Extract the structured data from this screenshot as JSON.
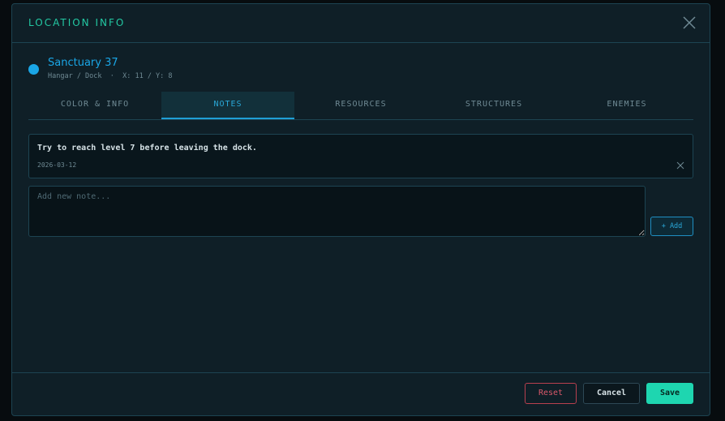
{
  "modal": {
    "title": "LOCATION INFO"
  },
  "location": {
    "name": "Sanctuary 37",
    "meta": "Hangar / Dock  ·  X: 11 / Y: 8",
    "dot_color": "#1aa6e6"
  },
  "tabs": [
    {
      "label": "COLOR & INFO",
      "active": false
    },
    {
      "label": "NOTES",
      "active": true
    },
    {
      "label": "RESOURCES",
      "active": false
    },
    {
      "label": "STRUCTURES",
      "active": false
    },
    {
      "label": "ENEMIES",
      "active": false
    }
  ],
  "notes": [
    {
      "text": "Try to reach level 7 before leaving the dock.",
      "date": "2026-03-12"
    }
  ],
  "new_note": {
    "placeholder": "Add new note...",
    "value": "",
    "add_label": "+ Add"
  },
  "footer": {
    "reset_label": "Reset",
    "cancel_label": "Cancel",
    "save_label": "Save"
  },
  "colors": {
    "accent": "#23c9a3",
    "primary": "#1aa6e6",
    "danger": "#d9586a",
    "save": "#1ed6b0"
  },
  "icons": {
    "close": "close-icon",
    "note_delete": "close-icon"
  }
}
